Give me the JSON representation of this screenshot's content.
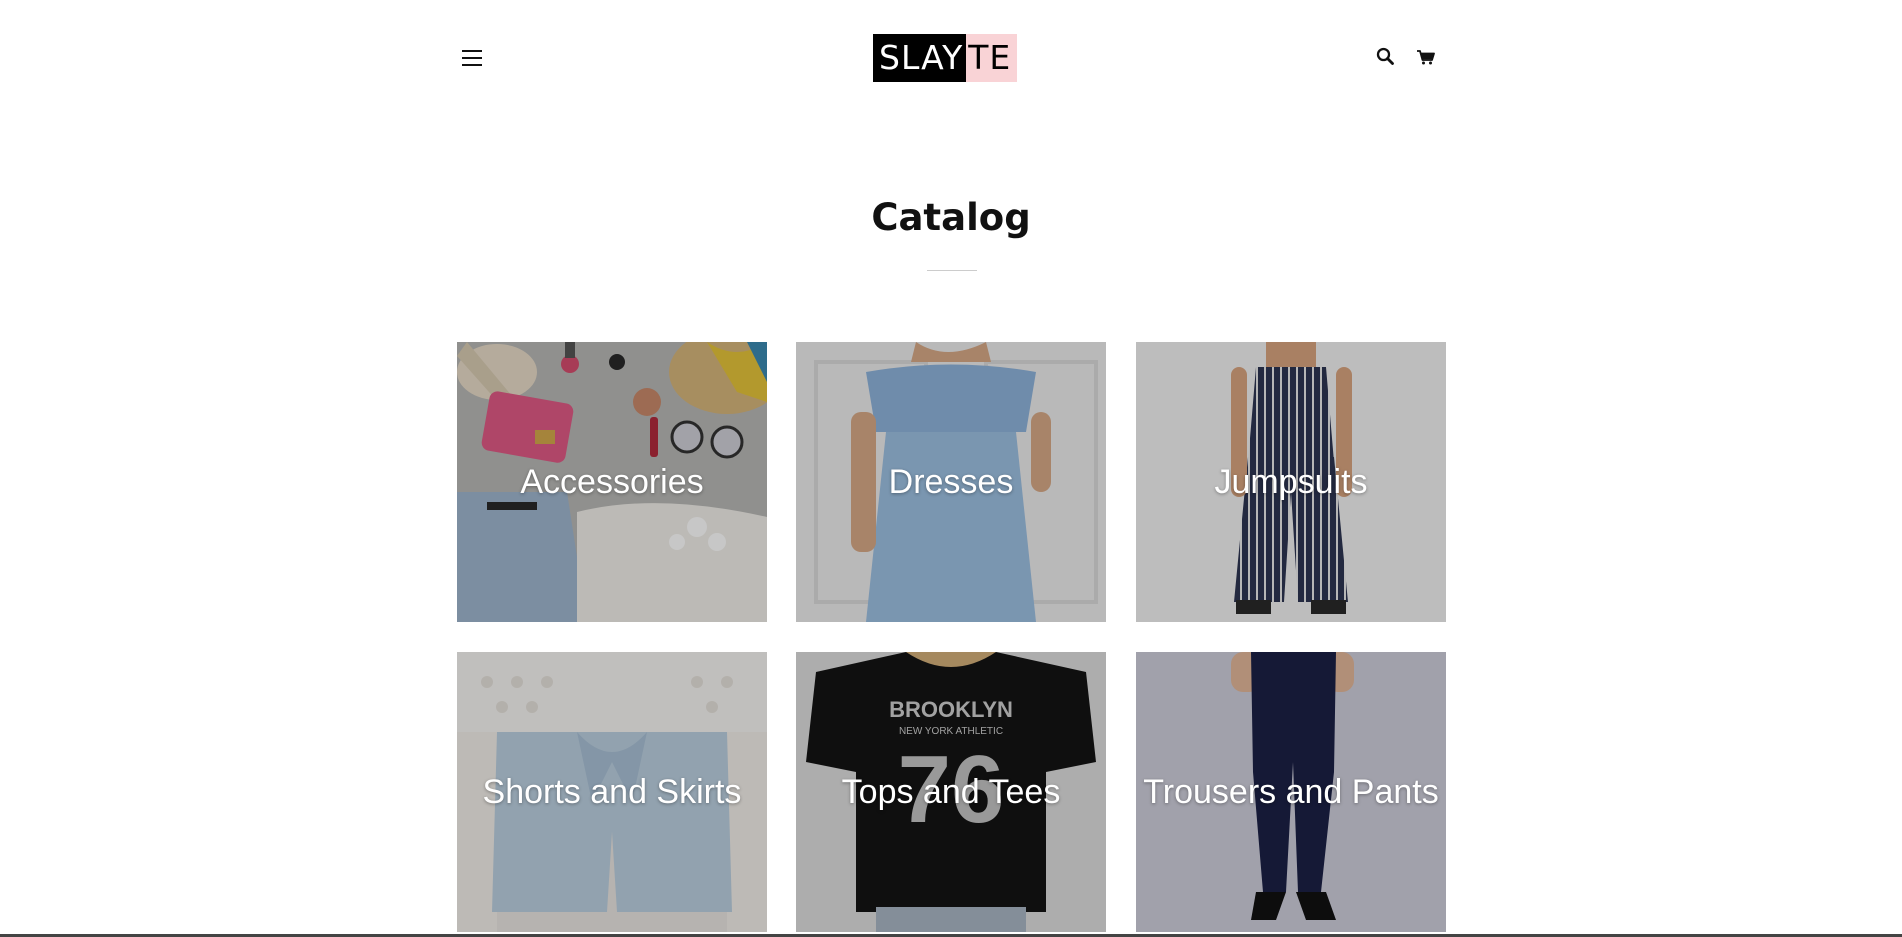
{
  "header": {
    "menu_icon": "hamburger-icon",
    "logo": {
      "part1": "SLAY",
      "part2": "TE",
      "part1_bg": "#000000",
      "part2_bg": "#f9d3d6"
    },
    "search_icon": "search-icon",
    "cart_icon": "cart-icon"
  },
  "page": {
    "title": "Catalog"
  },
  "collections": [
    {
      "label": "Accessories"
    },
    {
      "label": "Dresses"
    },
    {
      "label": "Jumpsuits"
    },
    {
      "label": "Shorts and Skirts"
    },
    {
      "label": "Tops and Tees"
    },
    {
      "label": "Trousers and Pants"
    }
  ],
  "colors": {
    "overlay": "rgba(0,0,0,0.22)",
    "accent_pink": "#f9d3d6"
  }
}
